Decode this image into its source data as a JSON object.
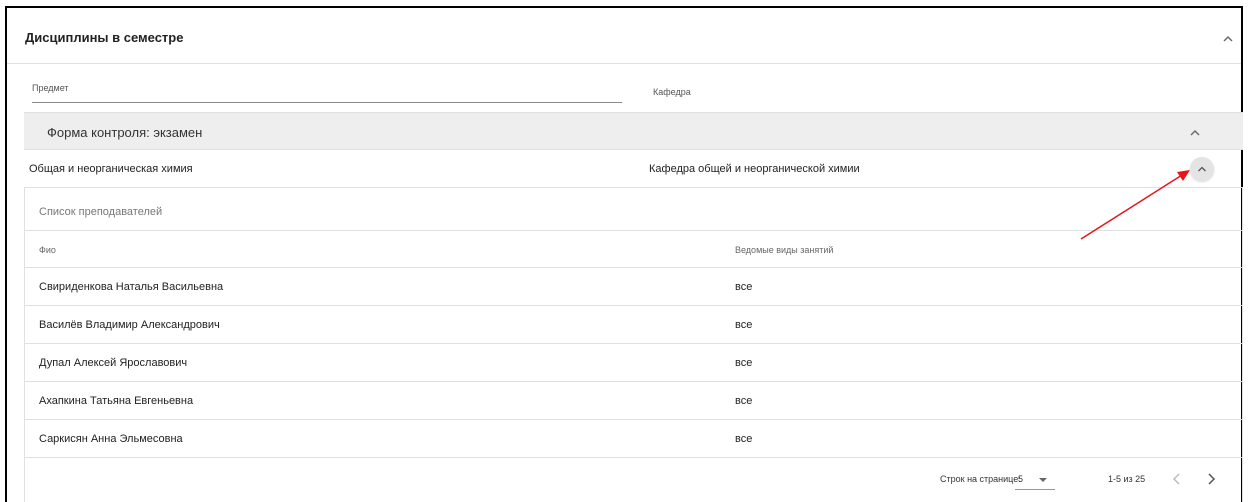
{
  "card": {
    "title": "Дисциплины в семестре"
  },
  "filters": {
    "subject_placeholder": "Предмет",
    "department_placeholder": "Кафедра"
  },
  "group": {
    "title": "Форма контроля: экзамен"
  },
  "discipline": {
    "name": "Общая и неорганическая химия",
    "department": "Кафедра общей и неорганической химии"
  },
  "teachers": {
    "title": "Список преподавателей",
    "columns": [
      "Фио",
      "Ведомые виды занятий"
    ],
    "rows": [
      {
        "name": "Свириденкова Наталья Васильевна",
        "lessons": "все"
      },
      {
        "name": "Василёв Владимир Александрович",
        "lessons": "все"
      },
      {
        "name": "Дупал Алексей Ярославович",
        "lessons": "все"
      },
      {
        "name": "Ахапкина Татьяна Евгеньевна",
        "lessons": "все"
      },
      {
        "name": "Саркисян Анна Эльмесовна",
        "lessons": "все"
      }
    ]
  },
  "pagination": {
    "rows_label": "Строк на странице:",
    "rows_value": "5",
    "range": "1-5 из 25"
  },
  "icons": {
    "card_collapse": "chevron-up-icon",
    "group_collapse": "chevron-up-icon",
    "row_collapse": "chevron-up-icon",
    "prev": "chevron-left-icon",
    "next": "chevron-right-icon"
  },
  "colors": {
    "annotation_arrow": "#e8141c",
    "group_header_bg": "#eeeeee"
  }
}
